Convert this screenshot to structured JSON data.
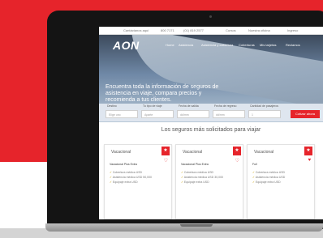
{
  "colors": {
    "accent": "#e6242b",
    "laptop": "#141414"
  },
  "site": {
    "logo": "AON",
    "top_links": [
      "Cantáctanos aquí",
      "800 7171",
      "(01) 819 2577",
      "Cursos",
      "Nuestra oficina",
      "Ingreso"
    ],
    "nav": [
      "Home",
      "Asistencia",
      "Asistencia y cobertura",
      "Coberturas",
      "Mis tarjetas",
      "Reclamos"
    ],
    "hero_text": "Encuentra toda la información de seguros de asistencia en viaje, compara precios y recomienda a tus clientes."
  },
  "form": {
    "fields": [
      {
        "label": "Destino",
        "value": "Elige uno"
      },
      {
        "label": "Tu tipo de viaje",
        "value": "Aparte"
      },
      {
        "label": "Fecha de salida",
        "value": "dd/mm"
      },
      {
        "label": "Fecha de regreso",
        "value": "dd/mm"
      },
      {
        "label": "Cantidad de pasajeros",
        "value": "1"
      }
    ],
    "submit_label": "Cotizar ahora"
  },
  "section_title": "Los seguros más solicitados para viajar",
  "cards": [
    {
      "label": "Vacacional",
      "subtitle": "Vacacional Plus Extra",
      "lines": [
        "Cobertura médica USD",
        "Asistencia médica USD 50,000",
        "Equipaje extra USD"
      ]
    },
    {
      "label": "Vacacional",
      "subtitle": "Vacacional Plus Extra",
      "lines": [
        "Cobertura médica USD",
        "Asistencia médica USD 30,000",
        "Equipaje extra USD"
      ]
    },
    {
      "label": "Vacacional",
      "subtitle": "Full",
      "lines": [
        "Cobertura médica USD",
        "Asistencia médica USD",
        "Equipaje extra USD"
      ]
    }
  ]
}
